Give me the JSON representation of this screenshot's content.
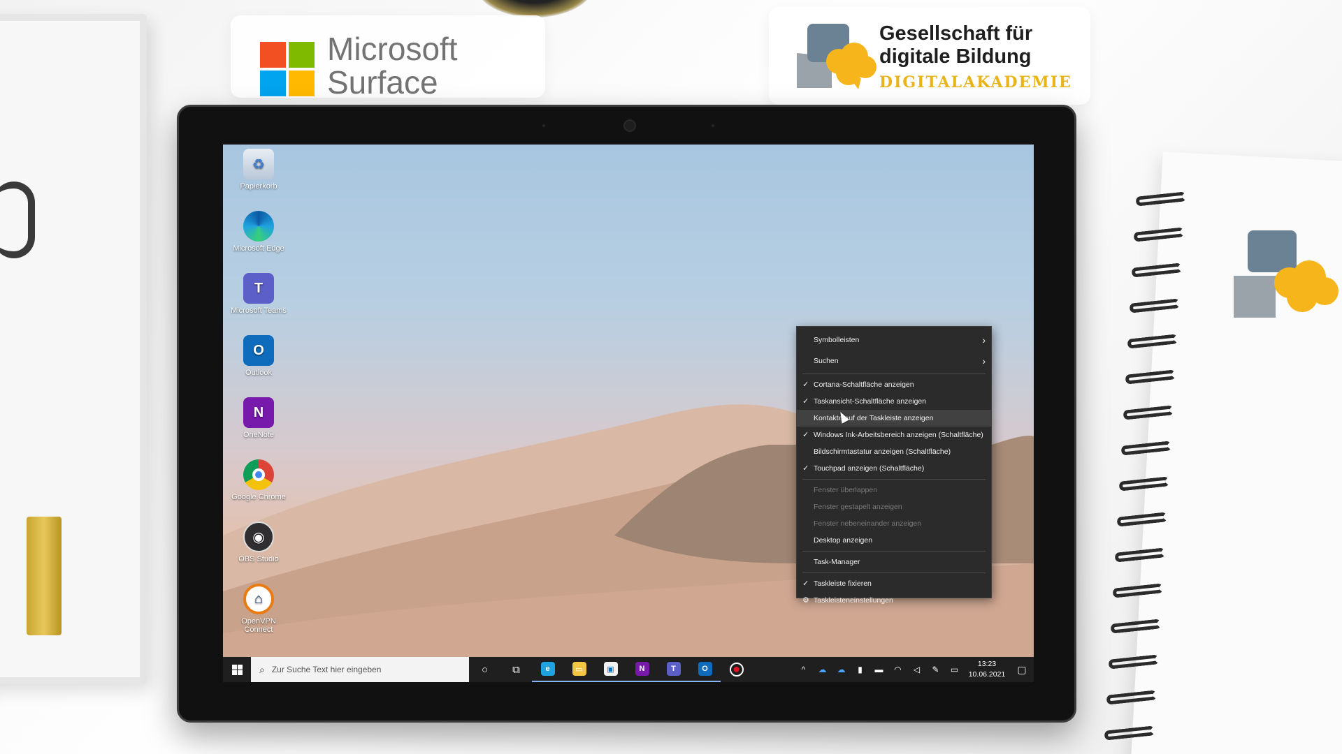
{
  "branding": {
    "microsoft": {
      "line1": "Microsoft",
      "line2": "Surface"
    },
    "academy": {
      "line1": "Gesellschaft für",
      "line2": "digitale Bildung",
      "line3": "DIGITALAKADEMIE"
    }
  },
  "desktop_icons": [
    {
      "label": "Papierkorb",
      "icon": "recycle-bin-icon",
      "glyph": "♻"
    },
    {
      "label": "Microsoft Edge",
      "icon": "edge-icon",
      "glyph": ""
    },
    {
      "label": "Microsoft Teams",
      "icon": "teams-icon",
      "glyph": "T"
    },
    {
      "label": "Outlook",
      "icon": "outlook-icon",
      "glyph": "O"
    },
    {
      "label": "OneNote",
      "icon": "onenote-icon",
      "glyph": "N"
    },
    {
      "label": "Google Chrome",
      "icon": "chrome-icon",
      "glyph": ""
    },
    {
      "label": "OBS Studio",
      "icon": "obs-icon",
      "glyph": "◉"
    },
    {
      "label": "OpenVPN Connect",
      "icon": "openvpn-icon",
      "glyph": "⌂"
    }
  ],
  "context_menu": {
    "items": [
      {
        "label": "Symbolleisten",
        "checked": false,
        "submenu": true
      },
      {
        "label": "Suchen",
        "checked": false,
        "submenu": true
      },
      {
        "label": "Cortana-Schaltfläche anzeigen",
        "checked": true
      },
      {
        "label": "Taskansicht-Schaltfläche anzeigen",
        "checked": true
      },
      {
        "label": "Kontakte auf der Taskleiste anzeigen",
        "checked": false,
        "hovered": true
      },
      {
        "label": "Windows Ink-Arbeitsbereich anzeigen (Schaltfläche)",
        "checked": true
      },
      {
        "label": "Bildschirmtastatur anzeigen (Schaltfläche)",
        "checked": false
      },
      {
        "label": "Touchpad anzeigen (Schaltfläche)",
        "checked": true
      },
      {
        "label": "Fenster überlappen",
        "disabled": true
      },
      {
        "label": "Fenster gestapelt anzeigen",
        "disabled": true
      },
      {
        "label": "Fenster nebeneinander anzeigen",
        "disabled": true
      },
      {
        "label": "Desktop anzeigen"
      },
      {
        "label": "Task-Manager"
      },
      {
        "label": "Taskleiste fixieren",
        "checked": true
      },
      {
        "label": "Taskleisteneinstellungen",
        "gear": true
      }
    ],
    "check_glyph": "✓",
    "arrow_glyph": "›",
    "gear_glyph": "⚙"
  },
  "taskbar": {
    "search_placeholder": "Zur Suche Text hier eingeben",
    "clock_time": "13:23",
    "clock_date": "10.06.2021",
    "apps": [
      {
        "name": "cortana-button",
        "glyph": "○"
      },
      {
        "name": "task-view-button",
        "glyph": "⧉"
      },
      {
        "name": "taskbar-edge",
        "glyph": "e",
        "color": "#1fa2e0"
      },
      {
        "name": "taskbar-explorer",
        "glyph": "▭",
        "color": "#f4c542"
      },
      {
        "name": "taskbar-store",
        "glyph": "▣",
        "color": "#f2f2f2"
      },
      {
        "name": "taskbar-onenote",
        "glyph": "N",
        "color": "#7719aa"
      },
      {
        "name": "taskbar-teams",
        "glyph": "T",
        "color": "#5b5fc7"
      },
      {
        "name": "taskbar-outlook",
        "glyph": "O",
        "color": "#0f6cbd"
      },
      {
        "name": "taskbar-record",
        "glyph": "●",
        "color": "#e81123"
      }
    ]
  }
}
